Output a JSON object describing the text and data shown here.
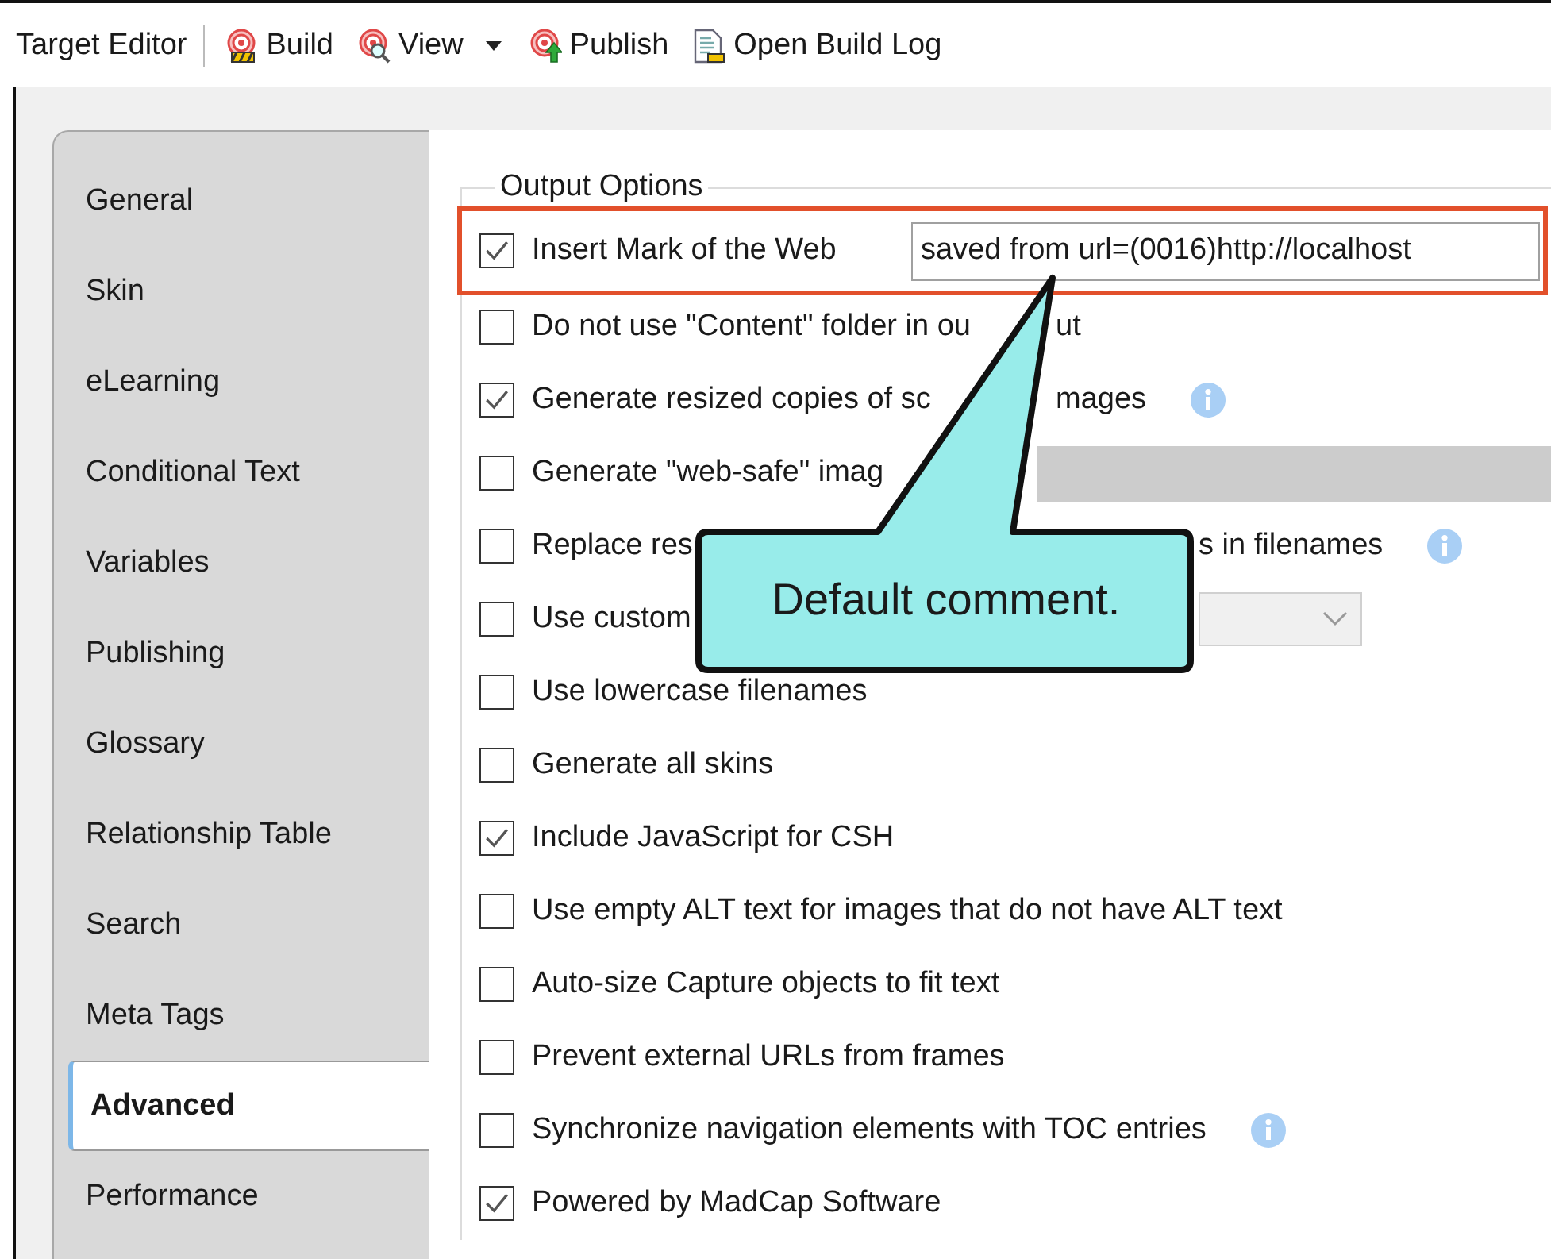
{
  "toolbar": {
    "title": "Target Editor",
    "buttons": [
      {
        "kind": "build",
        "label": "Build",
        "dropdown": false
      },
      {
        "kind": "view",
        "label": "View",
        "dropdown": true
      },
      {
        "kind": "publish",
        "label": "Publish",
        "dropdown": false
      },
      {
        "kind": "log",
        "label": "Open Build Log",
        "dropdown": false
      }
    ]
  },
  "tabs": [
    {
      "label": "General",
      "selected": false
    },
    {
      "label": "Skin",
      "selected": false
    },
    {
      "label": "eLearning",
      "selected": false
    },
    {
      "label": "Conditional Text",
      "selected": false
    },
    {
      "label": "Variables",
      "selected": false
    },
    {
      "label": "Publishing",
      "selected": false
    },
    {
      "label": "Glossary",
      "selected": false
    },
    {
      "label": "Relationship Table",
      "selected": false
    },
    {
      "label": "Search",
      "selected": false
    },
    {
      "label": "Meta Tags",
      "selected": false
    },
    {
      "label": "Advanced",
      "selected": true
    },
    {
      "label": "Performance",
      "selected": false
    }
  ],
  "output_options": {
    "title": "Output Options",
    "options": [
      {
        "label": "Insert Mark of the Web",
        "checked": true,
        "highlighted": true,
        "info": false,
        "control": {
          "kind": "text",
          "value": "saved from url=(0016)http://localhost"
        }
      },
      {
        "label": "Do not use \"Content\" folder in ou",
        "tail": "ut",
        "checked": false,
        "highlighted": false,
        "info": false
      },
      {
        "label": "Generate resized copies of sc",
        "tail": "mages",
        "checked": true,
        "highlighted": false,
        "info": true
      },
      {
        "label": "Generate \"web-safe\" imag",
        "checked": false,
        "highlighted": false,
        "info": false,
        "control": {
          "kind": "bar"
        }
      },
      {
        "label": "Replace res",
        "tail": "s in filenames",
        "checked": false,
        "highlighted": false,
        "info": true
      },
      {
        "label": "Use custom",
        "checked": false,
        "highlighted": false,
        "info": false,
        "control": {
          "kind": "dropdown"
        }
      },
      {
        "label": "Use lowercase filenames",
        "checked": false,
        "highlighted": false,
        "info": false
      },
      {
        "label": "Generate all skins",
        "checked": false,
        "highlighted": false,
        "info": false
      },
      {
        "label": "Include JavaScript for CSH",
        "checked": true,
        "highlighted": false,
        "info": false
      },
      {
        "label": "Use empty ALT text for images that do not have ALT text",
        "checked": false,
        "highlighted": false,
        "info": false
      },
      {
        "label": "Auto-size Capture objects to fit text",
        "checked": false,
        "highlighted": false,
        "info": false
      },
      {
        "label": "Prevent external URLs from frames",
        "checked": false,
        "highlighted": false,
        "info": false
      },
      {
        "label": "Synchronize navigation elements with TOC entries",
        "checked": false,
        "highlighted": false,
        "info": true
      },
      {
        "label": "Powered by MadCap Software",
        "checked": true,
        "highlighted": false,
        "info": false
      }
    ]
  },
  "callout": {
    "text": "Default comment."
  }
}
